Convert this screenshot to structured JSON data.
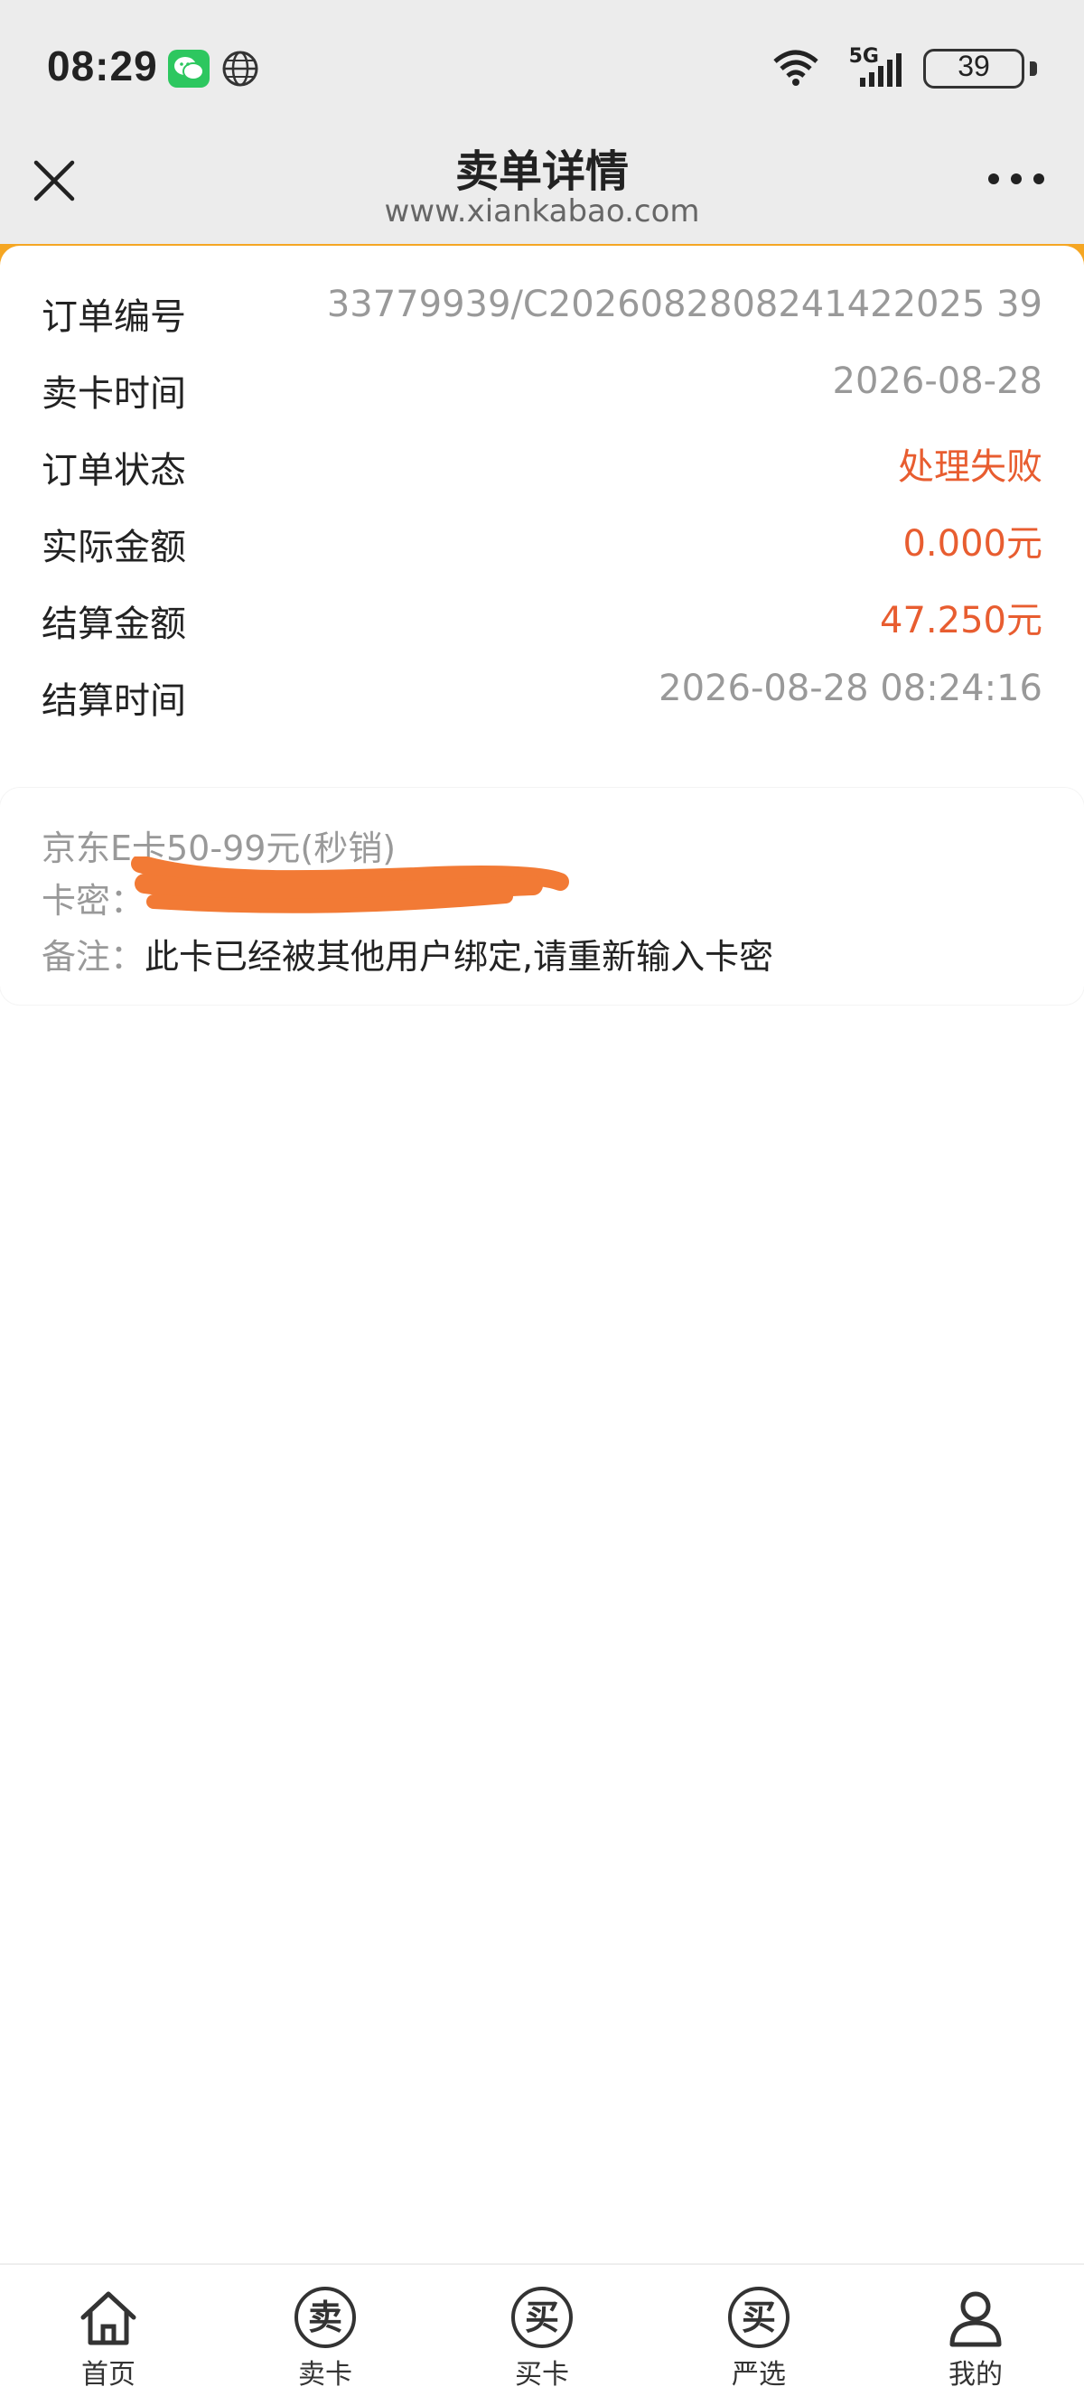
{
  "status_bar": {
    "time": "08:29",
    "network": "5G",
    "battery": "39",
    "icons": [
      "wechat-icon",
      "globe-icon",
      "wifi-icon",
      "signal-icon",
      "battery-icon"
    ]
  },
  "nav": {
    "title": "卖单详情",
    "subtitle": "www.xiankabao.com",
    "close_icon": "close-icon",
    "more_icon": "more-icon"
  },
  "order": {
    "rows": [
      {
        "label": "订单编号",
        "value": "33779939/C2026082808241422025 39"
      },
      {
        "label": "卖卡时间",
        "value": "2026-08-28"
      },
      {
        "label": "订单状态",
        "value": "处理失败"
      },
      {
        "label": "实际金额",
        "value": "0.000元"
      },
      {
        "label": "结算金额",
        "value": "47.250元"
      },
      {
        "label": "结算时间",
        "value": "2026-08-28 08:24:16"
      }
    ]
  },
  "card_info": {
    "product": "京东E卡50-99元(秒销)",
    "card_secret_label": "卡密：",
    "remark_label": "备注：",
    "remark_value": "此卡已经被其他用户绑定,请重新输入卡密"
  },
  "colors": {
    "accent_red": "#e85d30",
    "orange": "#f5a623",
    "muted": "#999999"
  },
  "tabbar": {
    "items": [
      {
        "label": "首页",
        "icon": "home-icon"
      },
      {
        "label": "卖卡",
        "icon": "sell-card-icon",
        "glyph": "卖"
      },
      {
        "label": "买卡",
        "icon": "buy-card-icon",
        "glyph": "买"
      },
      {
        "label": "严选",
        "icon": "selection-icon",
        "glyph": "买"
      },
      {
        "label": "我的",
        "icon": "user-icon"
      }
    ]
  }
}
